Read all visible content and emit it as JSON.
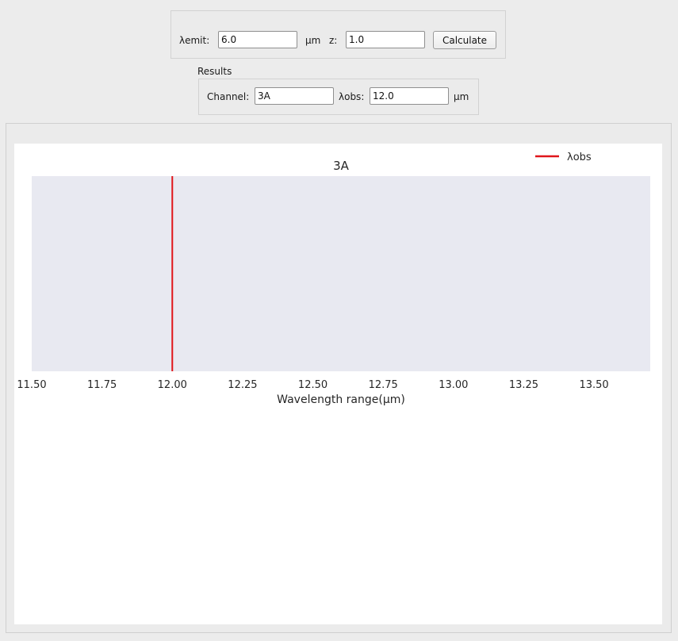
{
  "inputs": {
    "emit_label": "λemit:",
    "emit_value": "6.0",
    "emit_unit": "µm",
    "z_label": "z:",
    "z_value": "1.0",
    "calculate_label": "Calculate"
  },
  "results": {
    "group_title": "Results",
    "channel_label": "Channel:",
    "channel_value": "3A",
    "obs_label": "λobs:",
    "obs_value": "12.0",
    "obs_unit": "µm"
  },
  "chart_data": {
    "type": "line",
    "title": "3A",
    "xlabel": "Wavelength range(µm)",
    "ylabel": "",
    "xlim": [
      11.5,
      13.7
    ],
    "x_ticks": [
      "11.50",
      "11.75",
      "12.00",
      "12.25",
      "12.50",
      "12.75",
      "13.00",
      "13.25",
      "13.50"
    ],
    "grid": false,
    "legend_placement": "top-right",
    "series": [
      {
        "name": "λobs",
        "type": "vline",
        "x": 12.0,
        "color": "#e0161b"
      }
    ],
    "background_color": "#e8e9f1"
  }
}
